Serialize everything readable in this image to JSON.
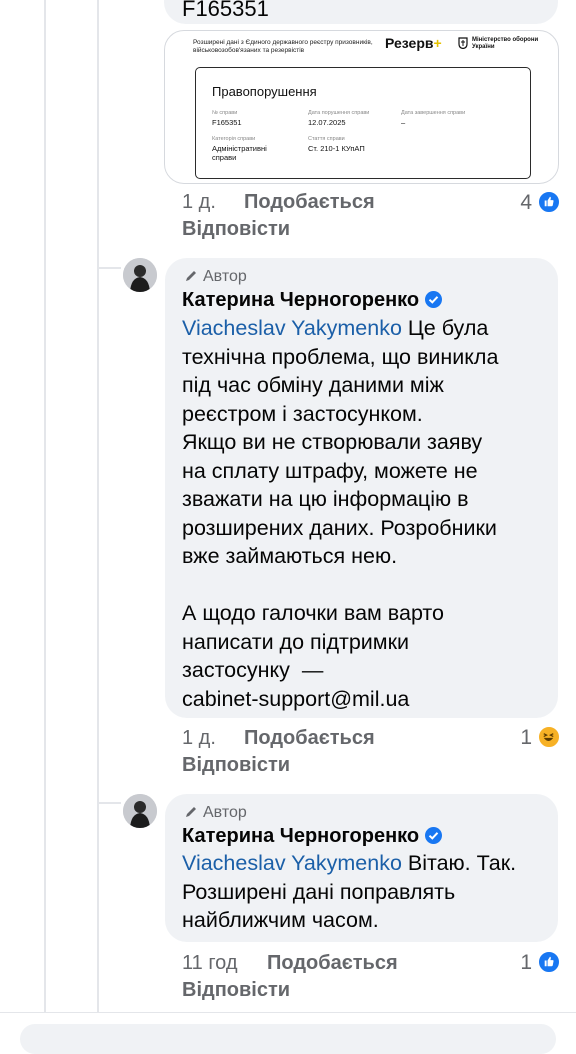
{
  "top_comment": {
    "text_partial": "F165351",
    "attachment": {
      "header_text": "Розширені дані з Єдиного державного реєстру призовників, військовозобов'язаних та резервістів",
      "brand": "Резерв",
      "brand_plus": "+",
      "ministry": "Міністерство оборони України",
      "card_title": "Правопорушення",
      "fields": [
        {
          "label": "№ справи",
          "value": "F165351"
        },
        {
          "label": "Дата порушення справи",
          "value": "12.07.2025"
        },
        {
          "label": "Дата завершення справи",
          "value": "–"
        },
        {
          "label": "Категорія справи",
          "value": "Адміністративні справи"
        },
        {
          "label": "Стаття справи",
          "value": "Ст. 210-1 КУпАП"
        }
      ]
    },
    "time": "1 д.",
    "like_label": "Подобається",
    "reply_label": "Відповісти",
    "reaction_count": "4"
  },
  "reply1": {
    "author_badge": "Автор",
    "author_name": "Катерина Черногоренко",
    "mention": "Viacheslav Yakymenko",
    "text": " Це була\nтехнічна проблема, що виникла\nпід час обміну даними між\nреєстром і застосунком.\nЯкщо ви не створювали заяву\nна сплату штрафу, можете не\nзважати на цю інформацію в\nрозширених даних. Розробники\nвже займаються нею.\n\nА щодо галочки вам варто\nнаписати до підтримки\nзастосунку  —\ncabinet-support@mil.ua",
    "time": "1 д.",
    "like_label": "Подобається",
    "reply_label": "Відповісти",
    "reaction_count": "1"
  },
  "reply2": {
    "author_badge": "Автор",
    "author_name": "Катерина Черногоренко",
    "mention": "Viacheslav Yakymenko",
    "text": " Вітаю. Так.\nРозширені дані поправлять\nнайближчим часом.",
    "time": "11 год",
    "like_label": "Подобається",
    "reply_label": "Відповісти",
    "reaction_count": "1"
  },
  "colors": {
    "like_blue": "#1877f2",
    "mention": "#1b5fa8",
    "bubble": "#f0f2f5",
    "meta_gray": "#65676b"
  }
}
